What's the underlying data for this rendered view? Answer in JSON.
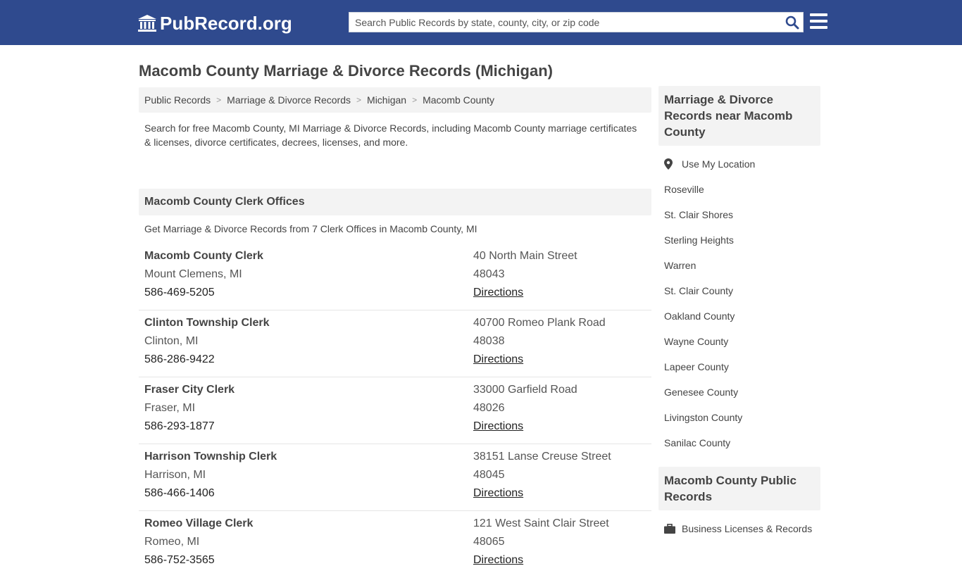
{
  "header": {
    "logo_text": "PubRecord.org",
    "search_placeholder": "Search Public Records by state, county, city, or zip code",
    "brand_color": "#2f4a8e"
  },
  "page_title": "Macomb County Marriage & Divorce Records (Michigan)",
  "breadcrumb": [
    "Public Records",
    "Marriage & Divorce Records",
    "Michigan",
    "Macomb County"
  ],
  "intro": "Search for free Macomb County, MI Marriage & Divorce Records, including Macomb County marriage certificates & licenses, divorce certificates, decrees, licenses, and more.",
  "clerk_section": {
    "title": "Macomb County Clerk Offices",
    "subtitle": "Get Marriage & Divorce Records from 7 Clerk Offices in Macomb County, MI",
    "offices": [
      {
        "name": "Macomb County Clerk",
        "city": "Mount Clemens, MI",
        "phone": "586-469-5205",
        "street": "40 North Main Street",
        "zip": "48043",
        "directions": "Directions"
      },
      {
        "name": "Clinton Township Clerk",
        "city": "Clinton, MI",
        "phone": "586-286-9422",
        "street": "40700 Romeo Plank Road",
        "zip": "48038",
        "directions": "Directions"
      },
      {
        "name": "Fraser City Clerk",
        "city": "Fraser, MI",
        "phone": "586-293-1877",
        "street": "33000 Garfield Road",
        "zip": "48026",
        "directions": "Directions"
      },
      {
        "name": "Harrison Township Clerk",
        "city": "Harrison, MI",
        "phone": "586-466-1406",
        "street": "38151 Lanse Creuse Street",
        "zip": "48045",
        "directions": "Directions"
      },
      {
        "name": "Romeo Village Clerk",
        "city": "Romeo, MI",
        "phone": "586-752-3565",
        "street": "121 West Saint Clair Street",
        "zip": "48065",
        "directions": "Directions"
      }
    ]
  },
  "sidebar": {
    "nearby_title": "Marriage & Divorce Records near Macomb County",
    "use_location": "Use My Location",
    "nearby": [
      "Roseville",
      "St. Clair Shores",
      "Sterling Heights",
      "Warren",
      "St. Clair County",
      "Oakland County",
      "Wayne County",
      "Lapeer County",
      "Genesee County",
      "Livingston County",
      "Sanilac County"
    ],
    "public_title": "Macomb County Public Records",
    "public_items": [
      "Business Licenses & Records"
    ]
  }
}
